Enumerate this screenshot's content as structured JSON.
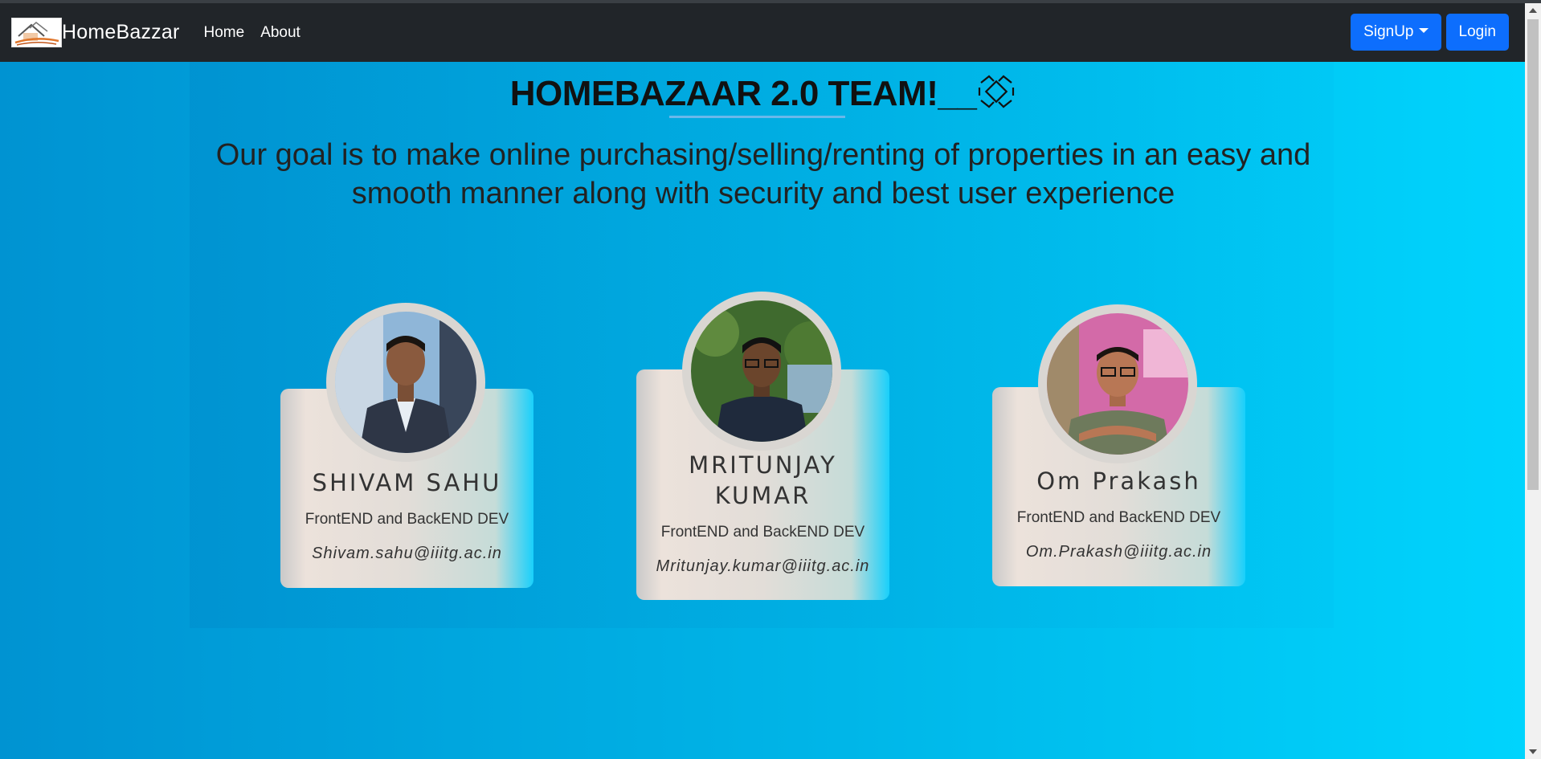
{
  "navbar": {
    "brand": "HomeBazzar",
    "links": [
      "Home",
      "About"
    ],
    "signup_label": "SignUp",
    "login_label": "Login"
  },
  "hero": {
    "title": "HOMEBAZAAR 2.0 TEAM!__",
    "subtitle": "Our goal is to make online purchasing/selling/renting of properties in an easy and smooth manner along with security and best user experience"
  },
  "team": [
    {
      "name": "SHIVAM SAHU",
      "role": "FrontEND and BackEND DEV",
      "email": "Shivam.sahu@iiitg.ac.in"
    },
    {
      "name": "MRITUNJAY KUMAR",
      "role": "FrontEND and BackEND DEV",
      "email": "Mritunjay.kumar@iiitg.ac.in"
    },
    {
      "name": "Om Prakash",
      "role": "FrontEND and BackEND DEV",
      "email": "Om.Prakash@iiitg.ac.in"
    }
  ],
  "colors": {
    "navbar": "#212529",
    "button": "#0d6efd",
    "background_start": "#0093d2",
    "background_end": "#00d4fd"
  },
  "icons": {
    "logo": "house-logo-icon",
    "title_icon": "teamwork-hands-icon",
    "signup_caret": "caret-down-icon"
  }
}
